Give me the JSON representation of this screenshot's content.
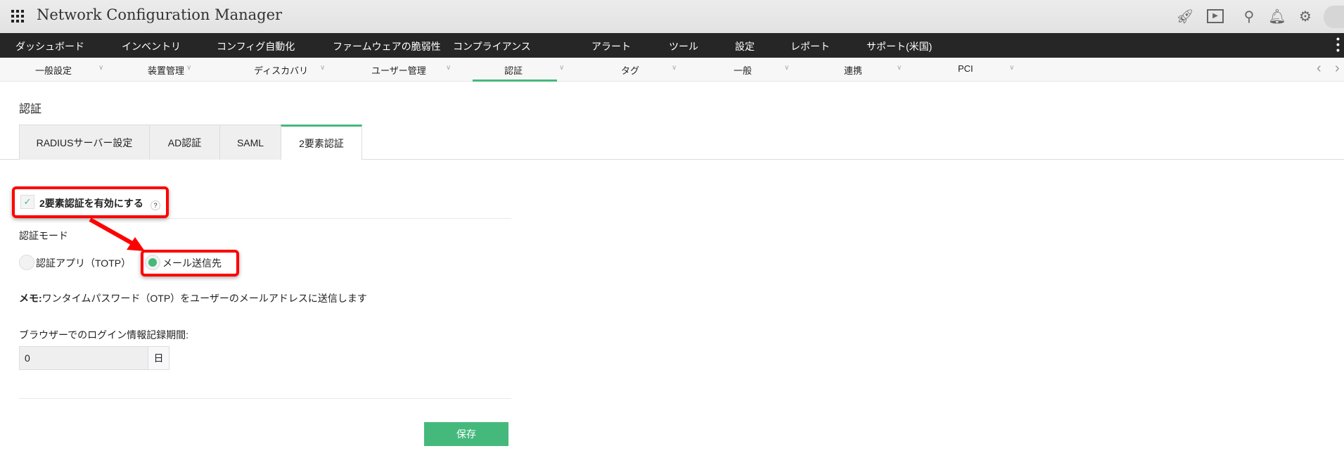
{
  "header": {
    "title": "Network Configuration Manager",
    "icons": [
      "rocket-icon",
      "presentation-icon",
      "search-icon",
      "bell-icon",
      "gear-icon",
      "user-avatar-icon"
    ]
  },
  "nav": [
    "ダッシュボード",
    "インベントリ",
    "コンフィグ自動化",
    "ファームウェアの脆弱性",
    "コンプライアンス",
    "アラート",
    "ツール",
    "設定",
    "レポート",
    "サポート(米国)"
  ],
  "subnav": [
    "一般設定",
    "装置管理",
    "ディスカバリ",
    "ユーザー管理",
    "認証",
    "タグ",
    "一般",
    "連携",
    "PCI"
  ],
  "page": {
    "heading": "認証",
    "tabs": [
      "RADIUSサーバー設定",
      "AD認証",
      "SAML",
      "2要素認証"
    ],
    "enable_label": "2要素認証を有効にする",
    "help": "?",
    "mode_label": "認証モード",
    "mode_options": [
      "認証アプリ（TOTP）",
      "メール送信先"
    ],
    "memo_prefix": "メモ:",
    "memo": "ワンタイムパスワード（OTP）をユーザーのメールアドレスに送信します",
    "remember_label": "ブラウザーでのログイン情報記録期間:",
    "remember_value": "0",
    "remember_unit": "日",
    "save": "保存"
  },
  "colors": {
    "accent": "#45b97c",
    "annotation": "#ff0000"
  }
}
